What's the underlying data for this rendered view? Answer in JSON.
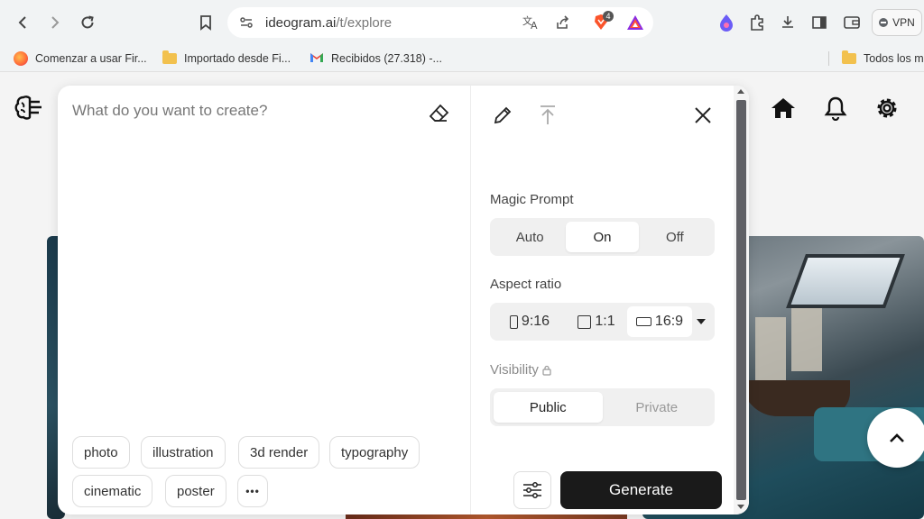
{
  "browser": {
    "url_host": "ideogram.ai",
    "url_path": "/t/explore",
    "extension_badge": "4",
    "vpn_label": "VPN"
  },
  "bookmarks": [
    {
      "label": "Comenzar a usar Fir...",
      "icon": "firefox-icon"
    },
    {
      "label": "Importado desde Fi...",
      "icon": "folder-icon"
    },
    {
      "label": "Recibidos (27.318) -...",
      "icon": "gmail-icon"
    },
    {
      "label": "Todos los m",
      "icon": "folder-icon"
    }
  ],
  "nav": {
    "icons": [
      "home-icon",
      "bell-icon",
      "gear-icon"
    ]
  },
  "create": {
    "placeholder": "What do you want to create?",
    "chips": [
      "photo",
      "illustration",
      "3d render",
      "typography",
      "cinematic",
      "poster"
    ],
    "more": "•••"
  },
  "settings": {
    "magic_prompt_label": "Magic Prompt",
    "magic_prompt_options": [
      "Auto",
      "On",
      "Off"
    ],
    "magic_prompt_selected": "On",
    "aspect_ratio_label": "Aspect ratio",
    "aspect_ratio_options": [
      "9:16",
      "1:1",
      "16:9"
    ],
    "aspect_ratio_selected": "16:9",
    "visibility_label": "Visibility",
    "visibility_options": [
      "Public",
      "Private"
    ],
    "visibility_selected": "Public",
    "generate_label": "Generate"
  },
  "colors": {
    "generate_bg": "#1a1a1a",
    "chrome_bg": "#f1f3f4"
  }
}
